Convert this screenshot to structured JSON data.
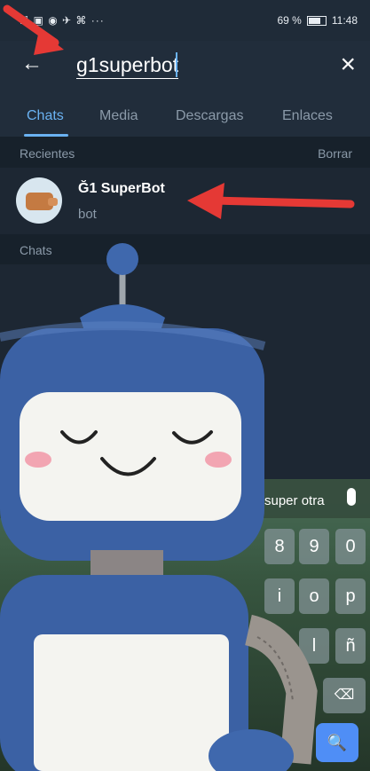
{
  "status_bar": {
    "left_icons": "ℍ ▣ ◉ ✈ ⌘ ···",
    "battery": "69 %",
    "time": "11:48"
  },
  "search": {
    "back_icon": "arrow-left-icon",
    "query": "g1superbot",
    "close_icon": "close-icon"
  },
  "tabs": [
    {
      "label": "Chats",
      "active": true
    },
    {
      "label": "Media",
      "active": false
    },
    {
      "label": "Descargas",
      "active": false
    },
    {
      "label": "Enlaces",
      "active": false
    }
  ],
  "recent_section": {
    "title": "Recientes",
    "action": "Borrar"
  },
  "result": {
    "name": "Ğ1 SuperBot",
    "subtitle": "bot",
    "avatar_icon": "wallet-icon"
  },
  "chats_section": {
    "title": "Chats"
  },
  "keyboard": {
    "suggestion": "super otra",
    "row1": [
      "8",
      "9",
      "0"
    ],
    "row2": [
      "i",
      "o",
      "p"
    ],
    "row3": [
      "l",
      "ñ"
    ],
    "backspace": "⌫",
    "search": "🔍",
    "mic_icon": "microphone-icon"
  },
  "colors": {
    "accent": "#6ab2f2",
    "annotation_arrow": "#e53935",
    "robot_body": "#3f68ad",
    "background": "#1d2733"
  }
}
